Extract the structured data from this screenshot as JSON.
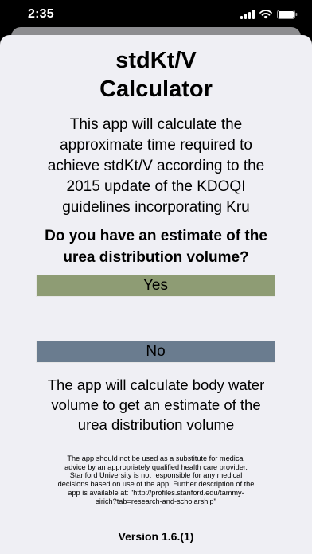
{
  "status_bar": {
    "time": "2:35",
    "icons": [
      "signal-icon",
      "wifi-icon",
      "battery-icon"
    ]
  },
  "header": {
    "title_line1": "stdKt/V",
    "title_line2": "Calculator"
  },
  "intro": {
    "line1": "This app will calculate the",
    "line2": "approximate time required to",
    "line3": "achieve stdKt/V according to the",
    "line4": "2015 update of the KDOQI",
    "line5": "guidelines incorporating Kru"
  },
  "question": {
    "line1": "Do you have an estimate of the",
    "line2": "urea distribution volume?"
  },
  "buttons": {
    "yes_label": "Yes",
    "no_label": "No"
  },
  "explanation": {
    "line1": "The app will calculate body water",
    "line2": "volume to get an estimate of the",
    "line3": "urea distribution volume"
  },
  "disclaimer": {
    "line1": "The app should not be used as a substitute for medical",
    "line2": "advice by an appropriately qualified health care provider.",
    "line3": "Stanford University is not responsible for any medical",
    "line4": "decisions based on use of the app. Further description of the",
    "line5": "app is available at:  \"http://profiles.stanford.edu/tammy-",
    "line6": "sirich?tab=research-and-scholarship\""
  },
  "footer": {
    "version": "Version 1.6.(1)"
  },
  "colors": {
    "yes_button": "#8e9c74",
    "no_button": "#6a7c8f",
    "sheet_background": "#efeff4"
  }
}
